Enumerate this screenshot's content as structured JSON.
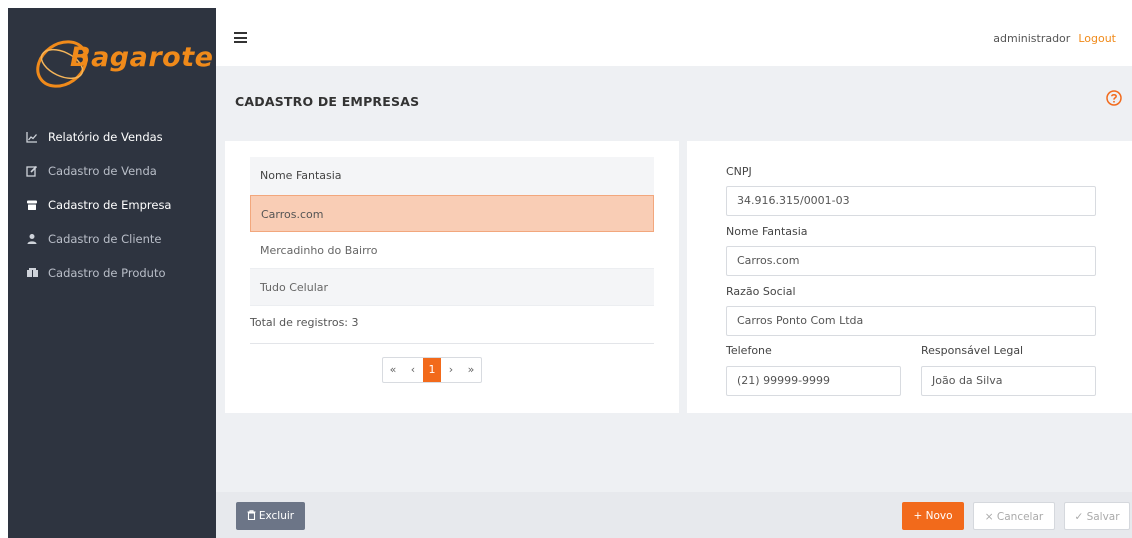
{
  "brand": {
    "name": "Bagarote",
    "accent": "#f08a1a"
  },
  "sidebar": {
    "items": [
      {
        "label": "Relatório de Vendas",
        "icon": "chart-line-icon"
      },
      {
        "label": "Cadastro de Venda",
        "icon": "edit-icon"
      },
      {
        "label": "Cadastro de Empresa",
        "icon": "store-icon",
        "active": true
      },
      {
        "label": "Cadastro de Cliente",
        "icon": "user-icon"
      },
      {
        "label": "Cadastro de Produto",
        "icon": "products-icon"
      }
    ]
  },
  "header": {
    "user": "administrador",
    "logout": "Logout"
  },
  "page": {
    "title": "CADASTRO DE EMPRESAS"
  },
  "table": {
    "header": "Nome Fantasia",
    "rows": [
      "Carros.com",
      "Mercadinho do Bairro",
      "Tudo Celular"
    ],
    "total": "Total de registros: 3"
  },
  "pagination": {
    "first": "«",
    "prev": "‹",
    "current": "1",
    "next": "›",
    "last": "»"
  },
  "form": {
    "cnpj_label": "CNPJ",
    "cnpj_value": "34.916.315/0001-03",
    "nome_label": "Nome Fantasia",
    "nome_value": "Carros.com",
    "razao_label": "Razão Social",
    "razao_value": "Carros Ponto Com Ltda",
    "telefone_label": "Telefone",
    "telefone_value": "(21) 99999-9999",
    "responsavel_label": "Responsável Legal",
    "responsavel_value": "João da Silva"
  },
  "actions": {
    "excluir": "Excluir",
    "novo": "+ Novo",
    "cancelar": "× Cancelar",
    "salvar": "✓ Salvar"
  }
}
